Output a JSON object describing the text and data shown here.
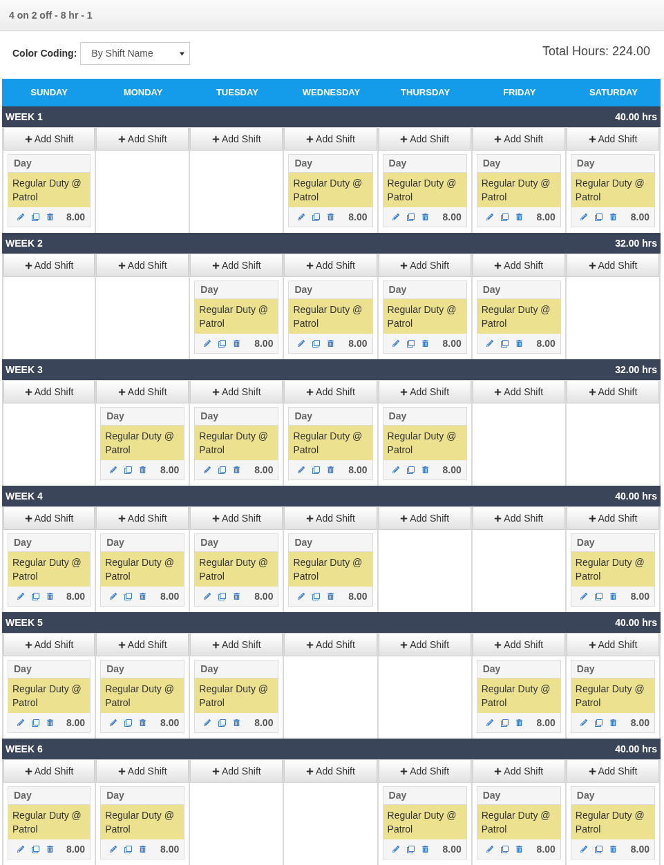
{
  "title": "4 on 2 off - 8 hr - 1",
  "color_coding": {
    "label": "Color Coding:",
    "value": "By Shift Name"
  },
  "total_hours": "Total Hours: 224.00",
  "days": [
    "SUNDAY",
    "MONDAY",
    "TUESDAY",
    "WEDNESDAY",
    "THURSDAY",
    "FRIDAY",
    "SATURDAY"
  ],
  "weeks": [
    {
      "label": "WEEK 1",
      "hours": "40.00 hrs",
      "cells": [
        {
          "add_label": "Add Shift",
          "shifts": [
            {
              "name": "Day",
              "title": "Regular Duty @ Patrol",
              "hours": "8.00",
              "color": "#ebe18f"
            }
          ]
        },
        {
          "add_label": "Add Shift"
        },
        {
          "add_label": "Add Shift"
        },
        {
          "add_label": "Add Shift",
          "shifts": [
            {
              "name": "Day",
              "title": "Regular Duty @ Patrol",
              "hours": "8.00",
              "color": "#ebe18f"
            }
          ]
        },
        {
          "add_label": "Add Shift",
          "shifts": [
            {
              "name": "Day",
              "title": "Regular Duty @ Patrol",
              "hours": "8.00",
              "color": "#ebe18f"
            }
          ]
        },
        {
          "add_label": "Add Shift",
          "shifts": [
            {
              "name": "Day",
              "title": "Regular Duty @ Patrol",
              "hours": "8.00",
              "color": "#ebe18f"
            }
          ]
        },
        {
          "add_label": "Add Shift",
          "shifts": [
            {
              "name": "Day",
              "title": "Regular Duty @ Patrol",
              "hours": "8.00",
              "color": "#ebe18f"
            }
          ]
        }
      ]
    },
    {
      "label": "WEEK 2",
      "hours": "32.00 hrs",
      "cells": [
        {
          "add_label": "Add Shift"
        },
        {
          "add_label": "Add Shift"
        },
        {
          "add_label": "Add Shift",
          "shifts": [
            {
              "name": "Day",
              "title": "Regular Duty @ Patrol",
              "hours": "8.00",
              "color": "#ebe18f"
            }
          ]
        },
        {
          "add_label": "Add Shift",
          "shifts": [
            {
              "name": "Day",
              "title": "Regular Duty @ Patrol",
              "hours": "8.00",
              "color": "#ebe18f"
            }
          ]
        },
        {
          "add_label": "Add Shift",
          "shifts": [
            {
              "name": "Day",
              "title": "Regular Duty @ Patrol",
              "hours": "8.00",
              "color": "#ebe18f"
            }
          ]
        },
        {
          "add_label": "Add Shift",
          "shifts": [
            {
              "name": "Day",
              "title": "Regular Duty @ Patrol",
              "hours": "8.00",
              "color": "#ebe18f"
            }
          ]
        },
        {
          "add_label": "Add Shift"
        }
      ]
    },
    {
      "label": "WEEK 3",
      "hours": "32.00 hrs",
      "cells": [
        {
          "add_label": "Add Shift"
        },
        {
          "add_label": "Add Shift",
          "shifts": [
            {
              "name": "Day",
              "title": "Regular Duty @ Patrol",
              "hours": "8.00",
              "color": "#ebe18f"
            }
          ]
        },
        {
          "add_label": "Add Shift",
          "shifts": [
            {
              "name": "Day",
              "title": "Regular Duty @ Patrol",
              "hours": "8.00",
              "color": "#ebe18f"
            }
          ]
        },
        {
          "add_label": "Add Shift",
          "shifts": [
            {
              "name": "Day",
              "title": "Regular Duty @ Patrol",
              "hours": "8.00",
              "color": "#ebe18f"
            }
          ]
        },
        {
          "add_label": "Add Shift",
          "shifts": [
            {
              "name": "Day",
              "title": "Regular Duty @ Patrol",
              "hours": "8.00",
              "color": "#ebe18f"
            }
          ]
        },
        {
          "add_label": "Add Shift"
        },
        {
          "add_label": "Add Shift"
        }
      ]
    },
    {
      "label": "WEEK 4",
      "hours": "40.00 hrs",
      "cells": [
        {
          "add_label": "Add Shift",
          "shifts": [
            {
              "name": "Day",
              "title": "Regular Duty @ Patrol",
              "hours": "8.00",
              "color": "#ebe18f"
            }
          ]
        },
        {
          "add_label": "Add Shift",
          "shifts": [
            {
              "name": "Day",
              "title": "Regular Duty @ Patrol",
              "hours": "8.00",
              "color": "#ebe18f"
            }
          ]
        },
        {
          "add_label": "Add Shift",
          "shifts": [
            {
              "name": "Day",
              "title": "Regular Duty @ Patrol",
              "hours": "8.00",
              "color": "#ebe18f"
            }
          ]
        },
        {
          "add_label": "Add Shift",
          "shifts": [
            {
              "name": "Day",
              "title": "Regular Duty @ Patrol",
              "hours": "8.00",
              "color": "#ebe18f"
            }
          ]
        },
        {
          "add_label": "Add Shift"
        },
        {
          "add_label": "Add Shift"
        },
        {
          "add_label": "Add Shift",
          "shifts": [
            {
              "name": "Day",
              "title": "Regular Duty @ Patrol",
              "hours": "8.00",
              "color": "#ebe18f"
            }
          ]
        }
      ]
    },
    {
      "label": "WEEK 5",
      "hours": "40.00 hrs",
      "cells": [
        {
          "add_label": "Add Shift",
          "shifts": [
            {
              "name": "Day",
              "title": "Regular Duty @ Patrol",
              "hours": "8.00",
              "color": "#ebe18f"
            }
          ]
        },
        {
          "add_label": "Add Shift",
          "shifts": [
            {
              "name": "Day",
              "title": "Regular Duty @ Patrol",
              "hours": "8.00",
              "color": "#ebe18f"
            }
          ]
        },
        {
          "add_label": "Add Shift",
          "shifts": [
            {
              "name": "Day",
              "title": "Regular Duty @ Patrol",
              "hours": "8.00",
              "color": "#ebe18f"
            }
          ]
        },
        {
          "add_label": "Add Shift"
        },
        {
          "add_label": "Add Shift"
        },
        {
          "add_label": "Add Shift",
          "shifts": [
            {
              "name": "Day",
              "title": "Regular Duty @ Patrol",
              "hours": "8.00",
              "color": "#ebe18f"
            }
          ]
        },
        {
          "add_label": "Add Shift",
          "shifts": [
            {
              "name": "Day",
              "title": "Regular Duty @ Patrol",
              "hours": "8.00",
              "color": "#ebe18f"
            }
          ]
        }
      ]
    },
    {
      "label": "WEEK 6",
      "hours": "40.00 hrs",
      "cells": [
        {
          "add_label": "Add Shift",
          "shifts": [
            {
              "name": "Day",
              "title": "Regular Duty @ Patrol",
              "hours": "8.00",
              "color": "#ebe18f"
            }
          ]
        },
        {
          "add_label": "Add Shift",
          "shifts": [
            {
              "name": "Day",
              "title": "Regular Duty @ Patrol",
              "hours": "8.00",
              "color": "#ebe18f"
            }
          ]
        },
        {
          "add_label": "Add Shift"
        },
        {
          "add_label": "Add Shift"
        },
        {
          "add_label": "Add Shift",
          "shifts": [
            {
              "name": "Day",
              "title": "Regular Duty @ Patrol",
              "hours": "8.00",
              "color": "#ebe18f"
            }
          ]
        },
        {
          "add_label": "Add Shift",
          "shifts": [
            {
              "name": "Day",
              "title": "Regular Duty @ Patrol",
              "hours": "8.00",
              "color": "#ebe18f"
            }
          ]
        },
        {
          "add_label": "Add Shift",
          "shifts": [
            {
              "name": "Day",
              "title": "Regular Duty @ Patrol",
              "hours": "8.00",
              "color": "#ebe18f"
            }
          ]
        }
      ]
    }
  ]
}
